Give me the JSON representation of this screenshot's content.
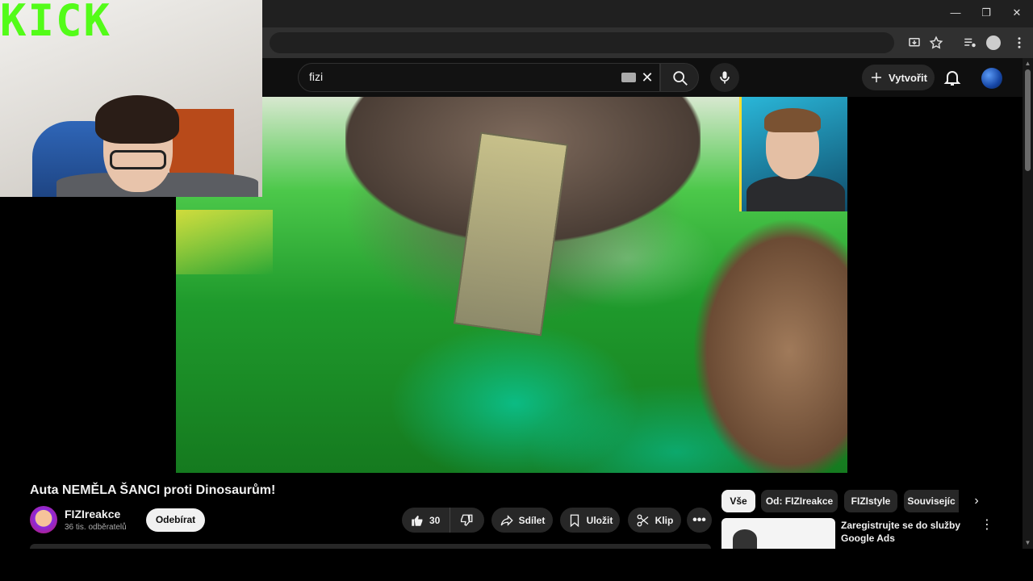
{
  "browser": {
    "window_controls": {
      "minimize": "—",
      "restore": "❐",
      "close": "✕"
    }
  },
  "youtube": {
    "search": {
      "query": "fizi"
    },
    "create_label": "Vytvořit",
    "video": {
      "title": "Auta NEMĚLA ŠANCI proti Dinosaurům!",
      "channel_name": "FIZIreakce",
      "subscribers": "36 tis. odběratelů",
      "subscribe_label": "Odebírat",
      "like_count": "30",
      "share_label": "Sdílet",
      "save_label": "Uložit",
      "clip_label": "Klip"
    },
    "chips": [
      "Vše",
      "Od: FIZIreakce",
      "FIZIstyle",
      "Souvisejíc"
    ],
    "ad": {
      "title": "Zaregistrujte se do služby Google Ads"
    }
  },
  "overlay": {
    "kick_logo": "KICK"
  },
  "colors": {
    "kick_green": "#53fc18",
    "background": "#0f0f0f",
    "pill": "#272727"
  }
}
